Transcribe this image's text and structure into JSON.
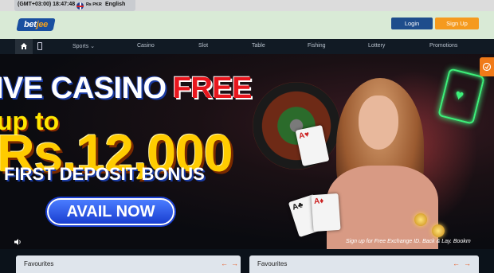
{
  "topbar": {
    "time": "(GMT+03:00) 18:47:48",
    "currency": "₨ PKR",
    "language": "English",
    "flag_icon": "uk-flag-icon"
  },
  "header": {
    "logo_part1": "bet",
    "logo_part2": "jee",
    "login_label": "Login",
    "signup_label": "Sign Up",
    "colors": {
      "login": "#1e4d8c",
      "signup": "#f59a1e",
      "header_bg": "#d9ead6"
    }
  },
  "nav": {
    "home_icon": "home-icon",
    "mobile_icon": "mobile-icon",
    "items": [
      {
        "label": "Sports ⌄"
      },
      {
        "label": "Casino"
      },
      {
        "label": "Slot"
      },
      {
        "label": "Table"
      },
      {
        "label": "Fishing"
      },
      {
        "label": "Lottery"
      },
      {
        "label": "Promotions"
      }
    ]
  },
  "banner": {
    "line1_white": "IVE CASINO",
    "line1_red": "FREE",
    "line2": "up to",
    "line3": "Rs.12,000",
    "line4": "FIRST DEPOSIT BONUS",
    "cta": "AVAIL NOW",
    "ticker": "Sign up for Free Exchange ID.  Back & Lay. Bookm",
    "volume_icon": "speaker-icon",
    "side_tab_icon": "gift-icon"
  },
  "favourites": [
    {
      "title": "Favourites"
    },
    {
      "title": "Favourites"
    }
  ]
}
